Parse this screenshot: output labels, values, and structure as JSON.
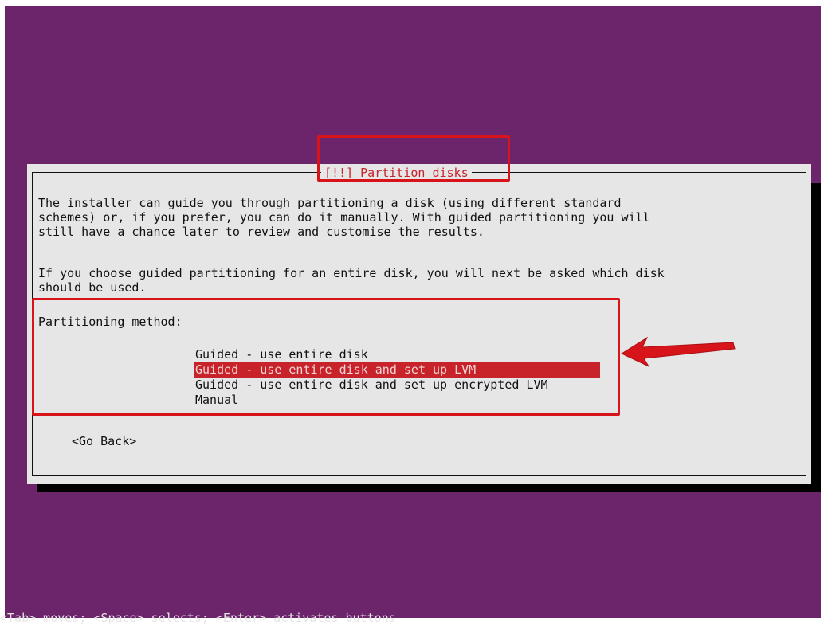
{
  "dialog": {
    "title": "[!!] Partition disks",
    "intro_lines": [
      "The installer can guide you through partitioning a disk (using different standard",
      "schemes) or, if you prefer, you can do it manually. With guided partitioning you will",
      "still have a chance later to review and customise the results."
    ],
    "guided_lines": [
      "If you choose guided partitioning for an entire disk, you will next be asked which disk",
      "should be used."
    ],
    "method_label": "Partitioning method:",
    "options": [
      "Guided - use entire disk",
      "Guided - use entire disk and set up LVM",
      "Guided - use entire disk and set up encrypted LVM",
      "Manual"
    ],
    "selected_option": "Guided - use entire disk and set up LVM",
    "go_back": "<Go Back>"
  },
  "status_bar": "<Tab> moves; <Space> selects; <Enter> activates buttons",
  "colors": {
    "background": "#6c246b",
    "dialog": "#e6e6e6",
    "accent": "#c8232a",
    "annotation": "#d8141b"
  },
  "annotations": [
    "title-highlight",
    "options-highlight",
    "arrow-icon"
  ]
}
